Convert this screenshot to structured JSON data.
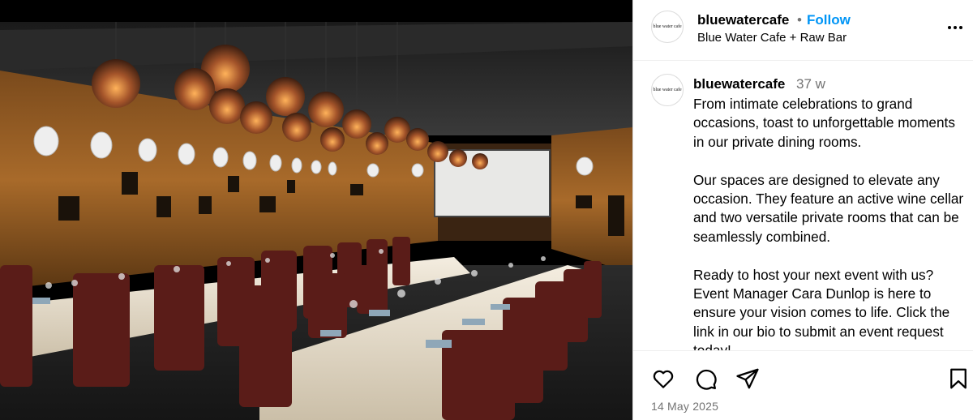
{
  "post": {
    "username": "bluewatercafe",
    "follow_label": "Follow",
    "location": "Blue Water Cafe + Raw Bar",
    "avatar_text": "blue water cafe",
    "photo_description_icon": "restaurant-private-dining-room-photo"
  },
  "caption": {
    "username": "bluewatercafe",
    "age": "37 w",
    "paragraphs": [
      "From intimate celebrations to grand occasions, toast to unforgettable moments in our private dining rooms.",
      "Our spaces are designed to elevate any occasion. They feature an active wine cellar and two versatile private rooms that can be seamlessly combined.",
      "Ready to host your next event with us? Event Manager Cara Dunlop is here to ensure your vision comes to life. Click the link in our bio to submit an event request today!"
    ]
  },
  "actions": {
    "icons": [
      "heart-icon",
      "comment-icon",
      "share-icon",
      "bookmark-icon"
    ]
  },
  "footer": {
    "date": "14 May 2025"
  }
}
